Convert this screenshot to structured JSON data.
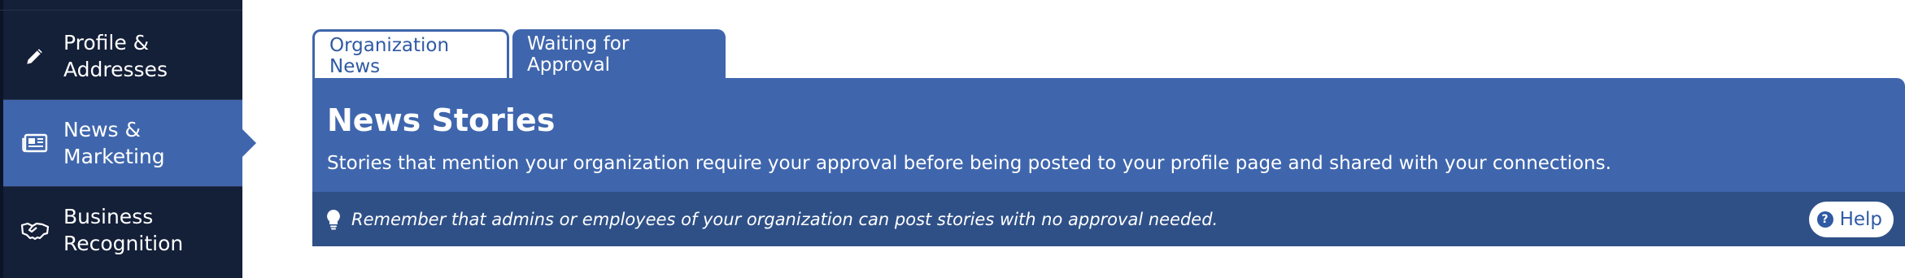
{
  "sidebar": {
    "items": [
      {
        "label": "Profile & Addresses",
        "icon": "pencil-icon"
      },
      {
        "label": "News & Marketing",
        "icon": "newspaper-icon",
        "active": true
      },
      {
        "label": "Business Recognition",
        "icon": "handshake-icon"
      }
    ]
  },
  "tabs": [
    {
      "label": "Organization News"
    },
    {
      "label": "Waiting for Approval",
      "active": true
    }
  ],
  "panel": {
    "title": "News Stories",
    "description": "Stories that mention your organization require your approval before being posted to your profile page and shared with your connections.",
    "notice": "Remember that admins or employees of your organization can post stories with no approval needed.",
    "help_label": "Help"
  },
  "colors": {
    "sidebar_bg": "#141f38",
    "accent": "#3f66ad",
    "notice_bg": "#2f5087"
  }
}
